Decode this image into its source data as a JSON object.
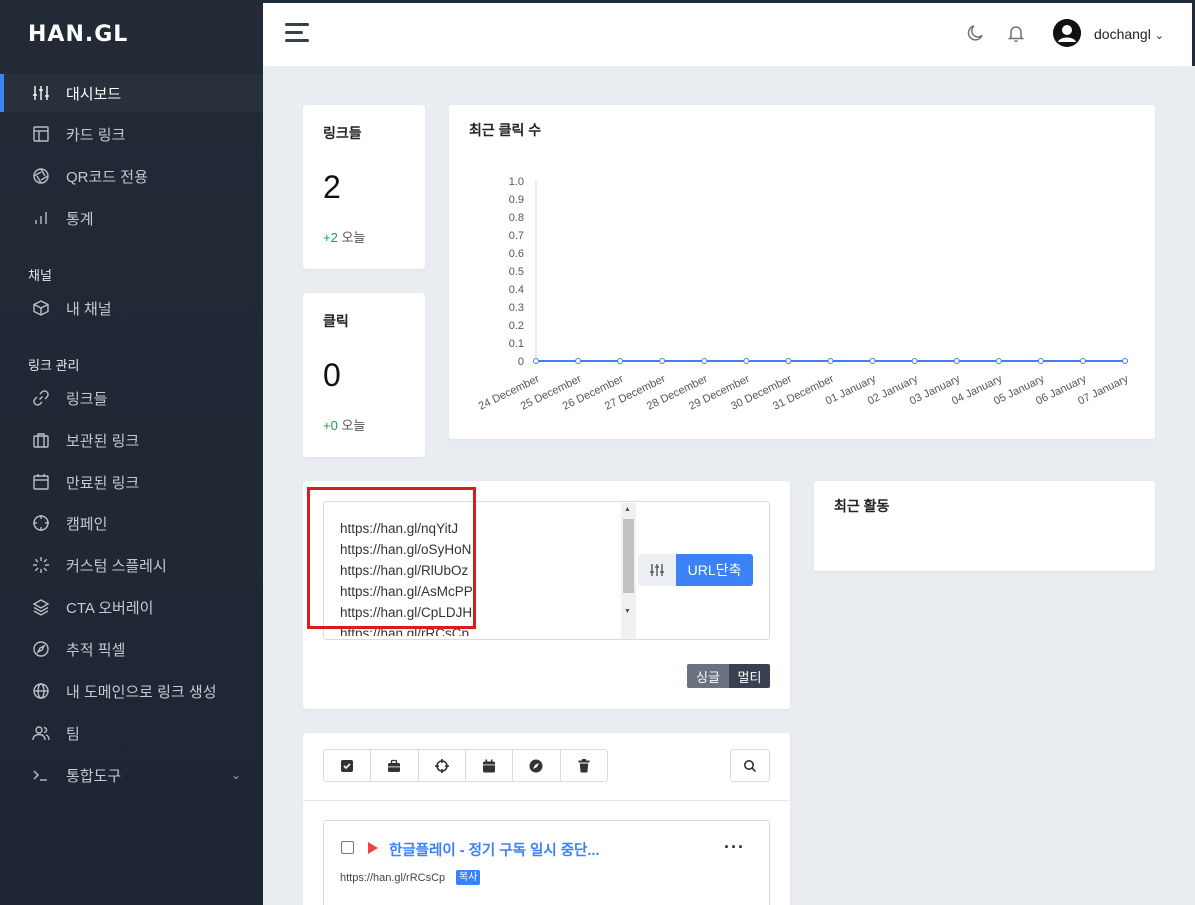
{
  "brand": {
    "logo": "HAN.GL"
  },
  "sidebar": {
    "items": [
      {
        "label": "대시보드",
        "icon": "sliders-icon"
      },
      {
        "label": "카드 링크",
        "icon": "layout-icon"
      },
      {
        "label": "QR코드 전용",
        "icon": "aperture-icon"
      },
      {
        "label": "통계",
        "icon": "bar-chart-icon"
      }
    ],
    "section_channel": "채널",
    "channel_items": [
      {
        "label": "내 채널",
        "icon": "box-icon"
      }
    ],
    "section_links": "링크 관리",
    "link_items": [
      {
        "label": "링크들",
        "icon": "link-icon"
      },
      {
        "label": "보관된 링크",
        "icon": "briefcase-icon"
      },
      {
        "label": "만료된 링크",
        "icon": "calendar-icon"
      },
      {
        "label": "캠페인",
        "icon": "crosshair-icon"
      },
      {
        "label": "커스텀 스플레시",
        "icon": "loader-icon"
      },
      {
        "label": "CTA 오버레이",
        "icon": "layers-icon"
      },
      {
        "label": "추적 픽셀",
        "icon": "compass-icon"
      },
      {
        "label": "내 도메인으로 링크 생성",
        "icon": "globe-icon"
      },
      {
        "label": "팀",
        "icon": "users-icon"
      },
      {
        "label": "통합도구",
        "icon": "terminal-icon"
      }
    ]
  },
  "topbar": {
    "username": "dochangl"
  },
  "stats": {
    "links": {
      "title": "링크들",
      "value": "2",
      "delta": "+2",
      "delta_label": "오늘"
    },
    "clicks": {
      "title": "클릭",
      "value": "0",
      "delta": "+0",
      "delta_label": "오늘"
    }
  },
  "chart_data": {
    "type": "line",
    "title": "최근 클릭 수",
    "categories": [
      "24 December",
      "25 December",
      "26 December",
      "27 December",
      "28 December",
      "29 December",
      "30 December",
      "31 December",
      "01 January",
      "02 January",
      "03 January",
      "04 January",
      "05 January",
      "06 January",
      "07 January"
    ],
    "values": [
      0,
      0,
      0,
      0,
      0,
      0,
      0,
      0,
      0,
      0,
      0,
      0,
      0,
      0,
      0
    ],
    "ylim": [
      0,
      1.0
    ],
    "yticks": [
      "1.0",
      "0.9",
      "0.8",
      "0.7",
      "0.6",
      "0.5",
      "0.4",
      "0.3",
      "0.2",
      "0.1",
      "0"
    ],
    "color": "#3b82f6"
  },
  "shortener": {
    "urls": [
      "https://han.gl/nqYitJ",
      "https://han.gl/oSyHoN",
      "https://han.gl/RlUbOz",
      "https://han.gl/AsMcPP",
      "https://han.gl/CpLDJH",
      "https://han.gl/rRCsCp"
    ],
    "button": "URL단축",
    "single": "싱글",
    "multi": "멀티"
  },
  "recent_activity": {
    "title": "최근 활동"
  },
  "link_list": {
    "item": {
      "title": "한글플레이 - 정기 구독 일시 중단...",
      "url": "https://han.gl/rRCsCp",
      "copy": "복사"
    }
  }
}
